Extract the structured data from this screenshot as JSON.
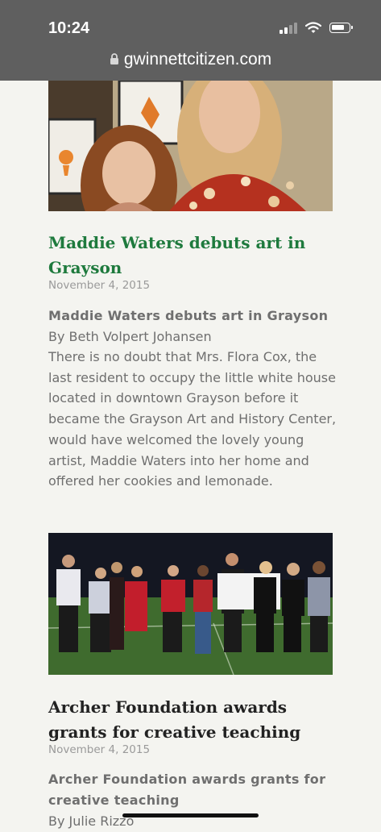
{
  "status_bar": {
    "time": "10:24"
  },
  "browser": {
    "url": "gwinnettcitizen.com"
  },
  "articles": [
    {
      "title": "Maddie Waters debuts art in Grayson",
      "date": "November 4, 2015",
      "excerpt_title": "Maddie Waters debuts art in Grayson",
      "byline": "By Beth Volpert Johansen",
      "body": "There is no doubt that Mrs. Flora Cox, the last resident to occupy the little white house located in downtown Grayson before it became the Grayson Art and History Center, would have welcomed the lovely young artist, Maddie Waters into her home and offered her cookies and lemonade."
    },
    {
      "title": "Archer Foundation awards grants for creative teaching",
      "date": "November 4, 2015",
      "excerpt_title": "Archer Foundation awards grants for creative teaching",
      "byline": "By Julie Rizzo"
    }
  ],
  "colors": {
    "title_green": "#1e7a3d",
    "status_bar": "#5f5f5f",
    "page_bg": "#f4f4f0"
  }
}
